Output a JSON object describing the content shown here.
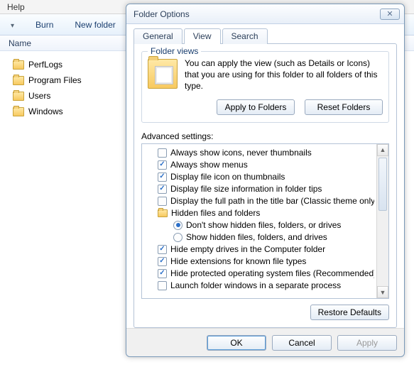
{
  "explorer": {
    "menu_help": "Help",
    "toolbar": {
      "burn": "Burn",
      "new_folder": "New folder"
    },
    "columns": {
      "name": "Name"
    },
    "items": [
      {
        "label": "PerfLogs"
      },
      {
        "label": "Program Files"
      },
      {
        "label": "Users"
      },
      {
        "label": "Windows"
      }
    ]
  },
  "dialog": {
    "title": "Folder Options",
    "tabs": {
      "general": "General",
      "view": "View",
      "search": "Search"
    },
    "folder_views": {
      "group_label": "Folder views",
      "text": "You can apply the view (such as Details or Icons) that you are using for this folder to all folders of this type.",
      "apply_btn": "Apply to Folders",
      "reset_btn": "Reset Folders"
    },
    "advanced": {
      "label": "Advanced settings:",
      "items": [
        {
          "type": "cb",
          "checked": false,
          "label": "Always show icons, never thumbnails"
        },
        {
          "type": "cb",
          "checked": true,
          "label": "Always show menus"
        },
        {
          "type": "cb",
          "checked": true,
          "label": "Display file icon on thumbnails"
        },
        {
          "type": "cb",
          "checked": true,
          "label": "Display file size information in folder tips"
        },
        {
          "type": "cb",
          "checked": false,
          "label": "Display the full path in the title bar (Classic theme only)"
        },
        {
          "type": "folder",
          "label": "Hidden files and folders"
        },
        {
          "type": "radio",
          "checked": true,
          "sub": true,
          "label": "Don't show hidden files, folders, or drives"
        },
        {
          "type": "radio",
          "checked": false,
          "sub": true,
          "label": "Show hidden files, folders, and drives"
        },
        {
          "type": "cb",
          "checked": true,
          "label": "Hide empty drives in the Computer folder"
        },
        {
          "type": "cb",
          "checked": true,
          "label": "Hide extensions for known file types"
        },
        {
          "type": "cb",
          "checked": true,
          "label": "Hide protected operating system files (Recommended)"
        },
        {
          "type": "cb",
          "checked": false,
          "label": "Launch folder windows in a separate process"
        }
      ]
    },
    "restore_btn": "Restore Defaults",
    "footer": {
      "ok": "OK",
      "cancel": "Cancel",
      "apply": "Apply"
    }
  }
}
